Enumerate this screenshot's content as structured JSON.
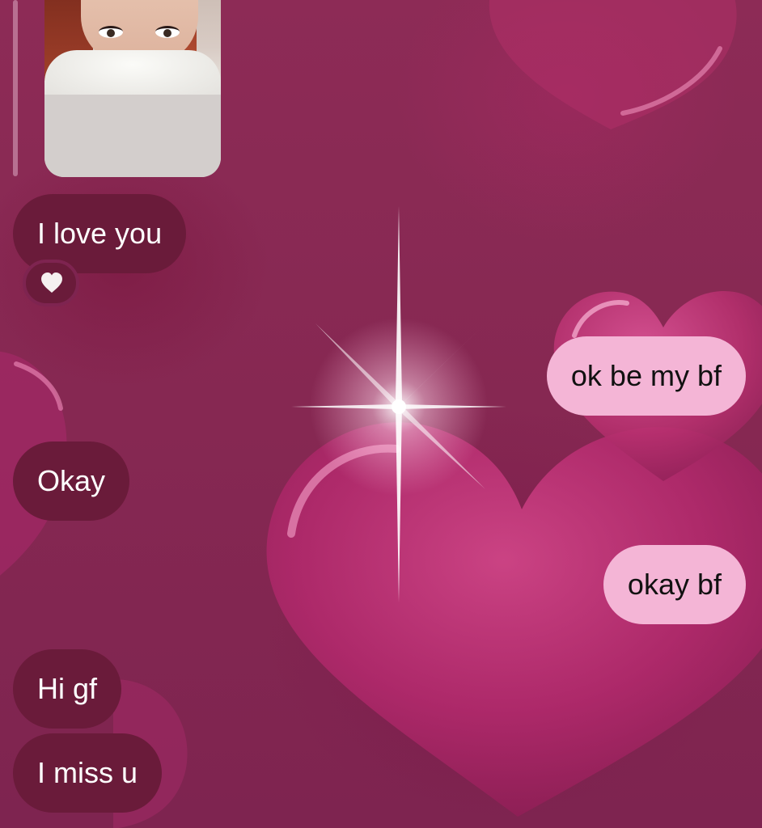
{
  "theme": {
    "incoming_bubble_color": "#6a1b3a",
    "outgoing_bubble_color": "#f4b5d6",
    "background_color": "#8c2a55"
  },
  "conversation": {
    "photo_attachment": {
      "icon": "photo-thumbnail"
    },
    "messages": [
      {
        "direction": "incoming",
        "text": "I love you",
        "reaction_icon": "white-heart-icon"
      },
      {
        "direction": "outgoing",
        "text": "ok be my bf"
      },
      {
        "direction": "incoming",
        "text": "Okay"
      },
      {
        "direction": "outgoing",
        "text": "okay bf"
      },
      {
        "direction": "incoming",
        "text": "Hi gf"
      },
      {
        "direction": "incoming",
        "text": "I miss u"
      }
    ]
  }
}
